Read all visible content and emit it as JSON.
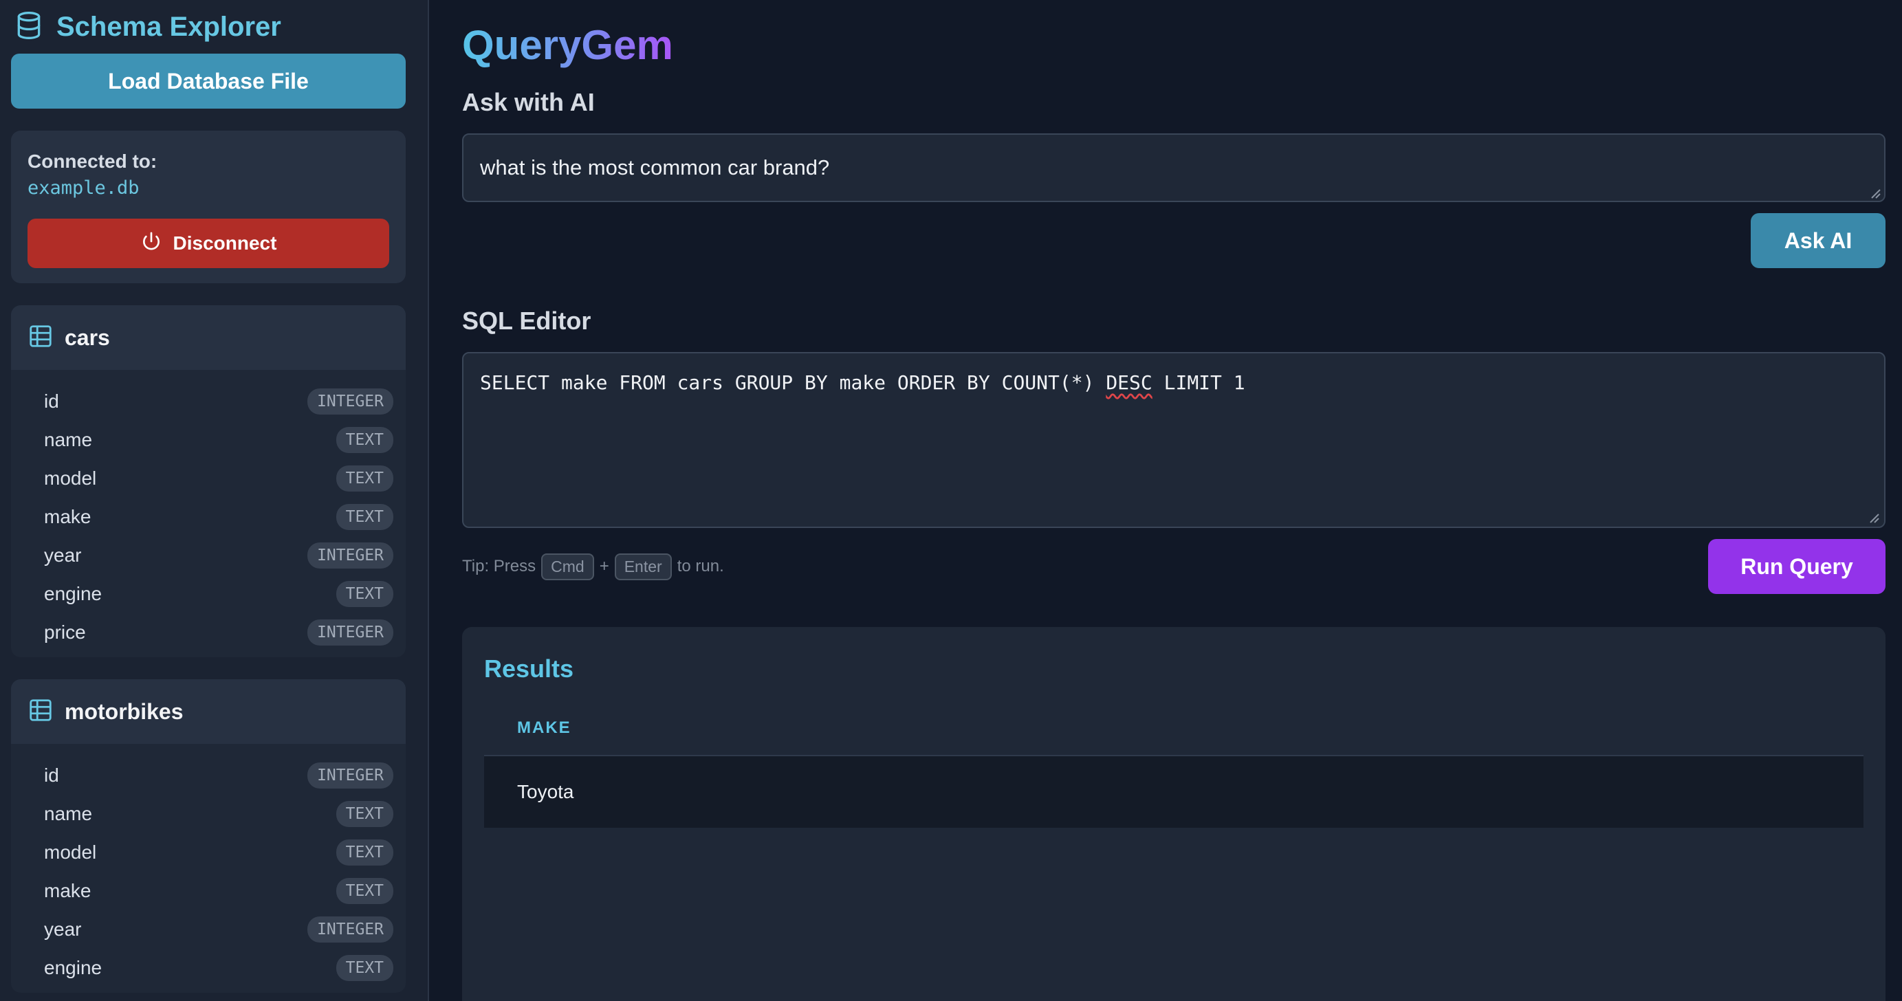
{
  "sidebar": {
    "title": "Schema Explorer",
    "load_button": "Load Database File",
    "connection": {
      "label": "Connected to:",
      "database": "example.db",
      "disconnect_button": "Disconnect"
    },
    "tables": [
      {
        "name": "cars",
        "columns": [
          {
            "name": "id",
            "type": "INTEGER"
          },
          {
            "name": "name",
            "type": "TEXT"
          },
          {
            "name": "model",
            "type": "TEXT"
          },
          {
            "name": "make",
            "type": "TEXT"
          },
          {
            "name": "year",
            "type": "INTEGER"
          },
          {
            "name": "engine",
            "type": "TEXT"
          },
          {
            "name": "price",
            "type": "INTEGER"
          }
        ]
      },
      {
        "name": "motorbikes",
        "columns": [
          {
            "name": "id",
            "type": "INTEGER"
          },
          {
            "name": "name",
            "type": "TEXT"
          },
          {
            "name": "model",
            "type": "TEXT"
          },
          {
            "name": "make",
            "type": "TEXT"
          },
          {
            "name": "year",
            "type": "INTEGER"
          },
          {
            "name": "engine",
            "type": "TEXT"
          }
        ]
      }
    ]
  },
  "main": {
    "brand": "QueryGem",
    "ask": {
      "label": "Ask with AI",
      "value": "what is the most common car brand?",
      "button": "Ask AI"
    },
    "sql": {
      "label": "SQL Editor",
      "query_before": "SELECT make FROM cars GROUP BY make ORDER BY COUNT(*) ",
      "query_flagged": "DESC",
      "query_after": " LIMIT 1",
      "tip_prefix": "Tip: Press",
      "tip_key1": "Cmd",
      "tip_plus": "+",
      "tip_key2": "Enter",
      "tip_suffix": "to run.",
      "run_button": "Run Query"
    },
    "results": {
      "title": "Results",
      "columns": [
        "MAKE"
      ],
      "rows": [
        [
          "Toyota"
        ]
      ]
    }
  },
  "colors": {
    "background": "#111827",
    "sidebar": "#1b2332",
    "accent_cyan": "#67c8e4",
    "load_button": "#3e93b5",
    "disconnect_button": "#b12d27",
    "run_button": "#9333ea"
  },
  "icons": {
    "sidebar_title": "database-icon",
    "disconnect": "power-icon",
    "table": "table-grid-icon"
  }
}
